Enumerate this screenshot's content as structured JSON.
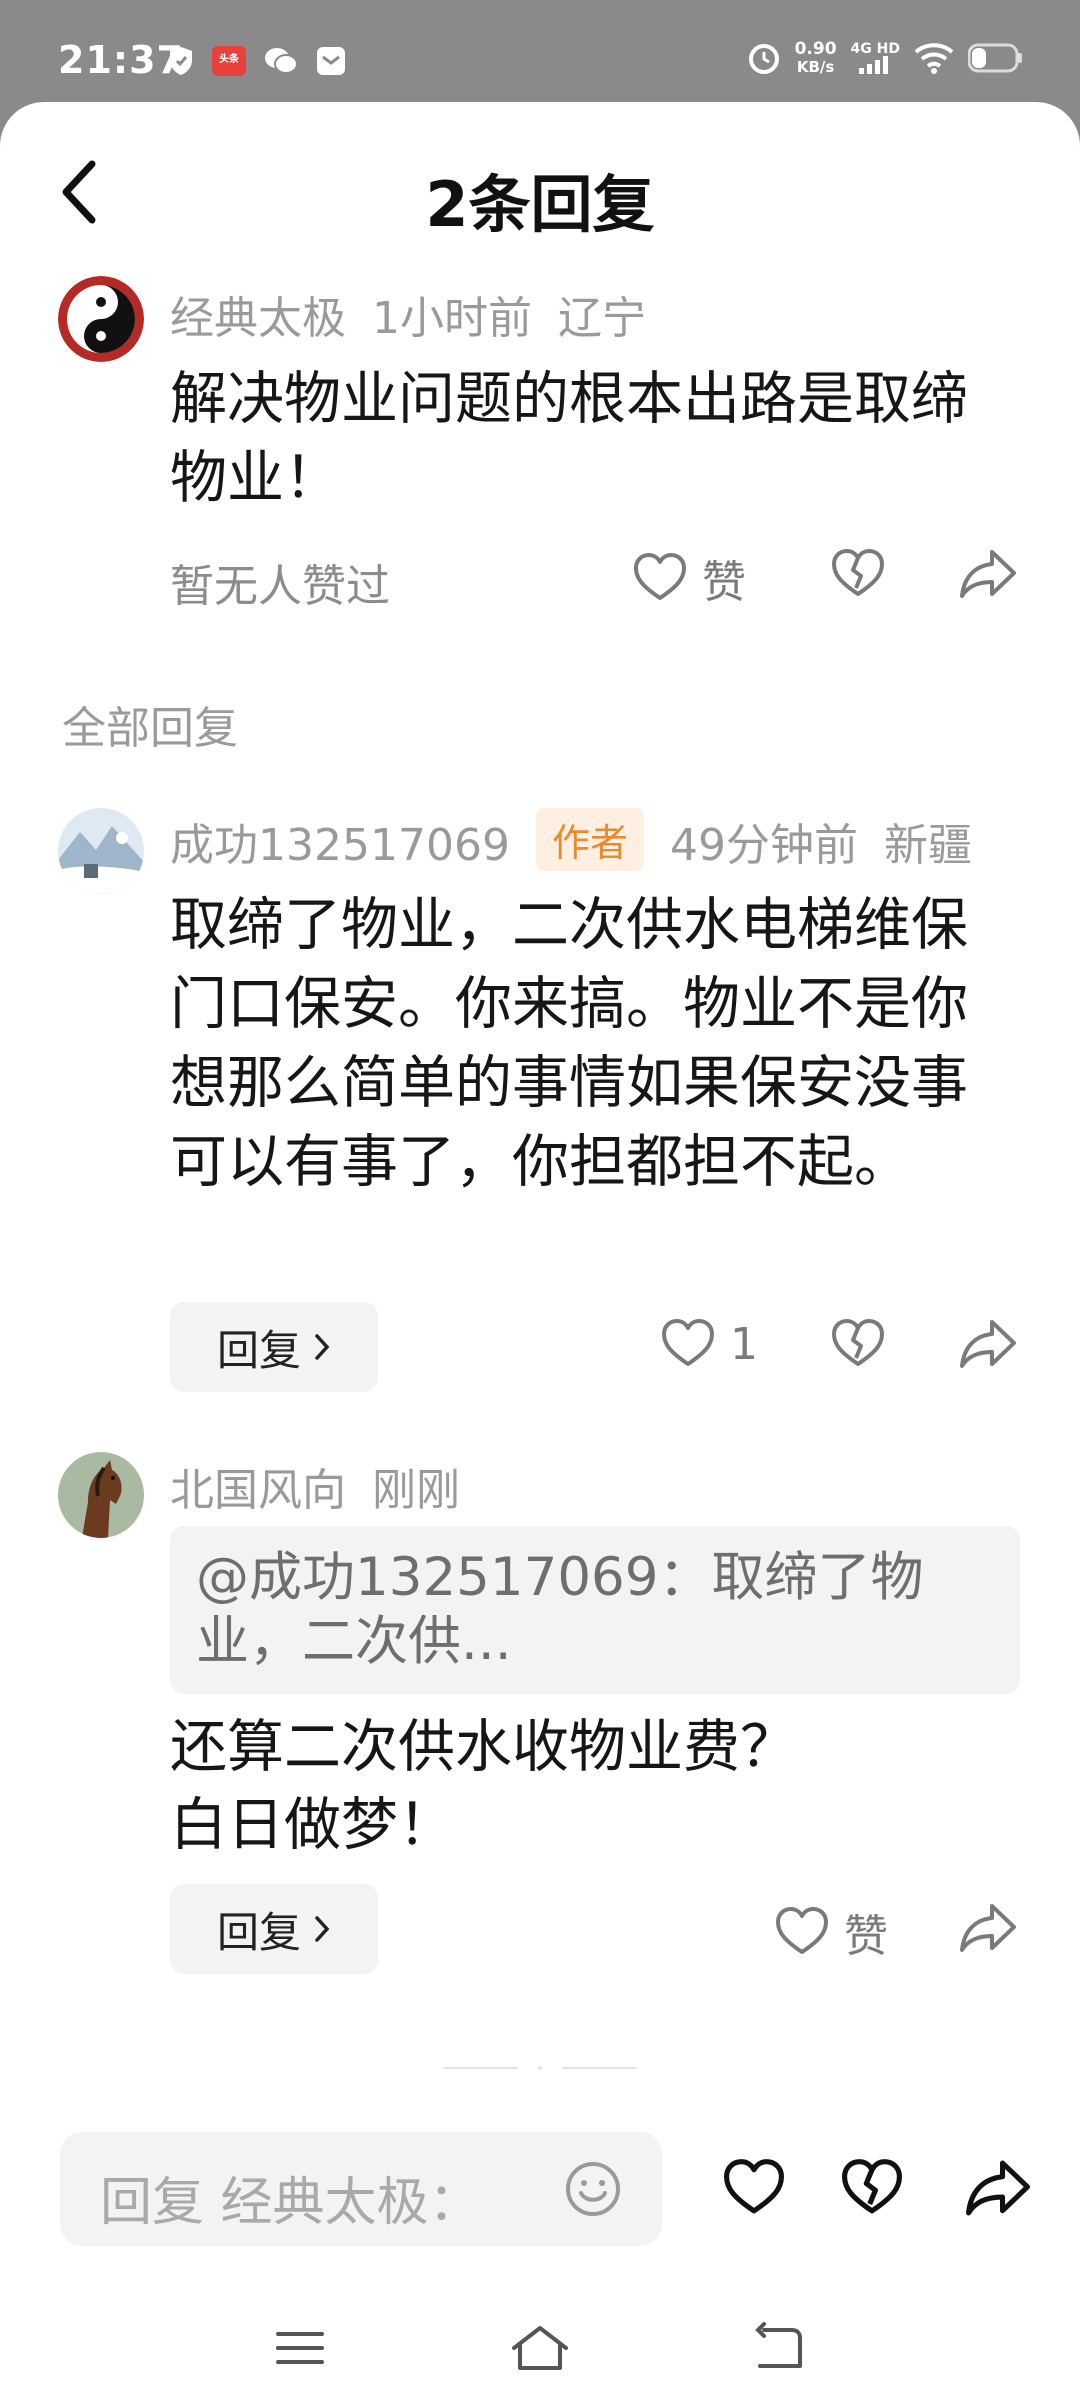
{
  "status_bar": {
    "time": "21:37",
    "net_speed_value": "0.90",
    "net_speed_unit": "KB/s",
    "net_type_top": "4G HD",
    "net_type_bottom": "",
    "app_badge": "头条",
    "icons": [
      "shield-icon",
      "toutiao-app-icon",
      "wechat-icon",
      "message-app-icon",
      "alarm-icon",
      "signal-icon",
      "wifi-icon",
      "battery-icon"
    ]
  },
  "header": {
    "title": "2条回复",
    "back_icon": "chevron-left-icon"
  },
  "main_comment": {
    "username": "经典太极",
    "time": "1小时前",
    "location": "辽宁",
    "text": "解决物业问题的根本出路是取缔物业！",
    "likes_info": "暂无人赞过",
    "like_label": "赞"
  },
  "replies_section": {
    "title": "全部回复"
  },
  "replies": [
    {
      "username": "成功132517069",
      "badge": "作者",
      "time": "49分钟前",
      "location": "新疆",
      "text": "取缔了物业，二次供水电梯维保门口保安。你来搞。物业不是你想那么简单的事情如果保安没事可以有事了，你担都担不起。",
      "reply_label": "回复",
      "like_count": "1"
    },
    {
      "username": "北国风向",
      "time": "刚刚",
      "quote": "@成功132517069：取缔了物业，二次供...",
      "text_line1": "还算二次供水收物业费？",
      "text_line2": "白日做梦！",
      "reply_label": "回复",
      "like_label": "赞"
    }
  ],
  "input": {
    "placeholder": "回复 经典太极："
  },
  "colors": {
    "accent_badge_bg": "#fdf0e2",
    "accent_badge_text": "#e98a2f",
    "muted_text": "#9a9a9a",
    "status_bar_bg": "#8a8a8a"
  }
}
